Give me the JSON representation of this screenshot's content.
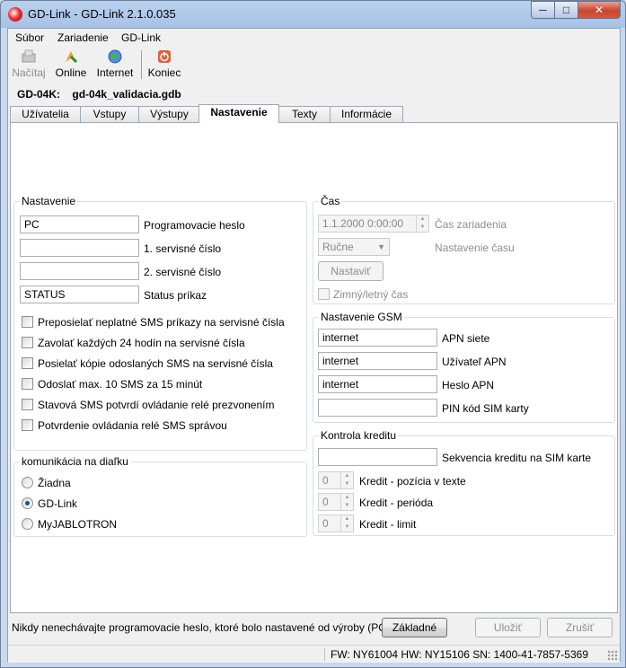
{
  "window": {
    "title": "GD-Link - GD-Link 2.1.0.035",
    "controls": {
      "minimize": "─",
      "maximize": "□",
      "close": "✕"
    }
  },
  "menu": [
    {
      "label": "Súbor"
    },
    {
      "label": "Zariadenie"
    },
    {
      "label": "GD-Link"
    }
  ],
  "toolbar": {
    "nacitaj": "Načítaj",
    "online": "Online",
    "internet": "Internet",
    "koniec": "Koniec"
  },
  "device": {
    "label": "GD-04K:",
    "file": "gd-04k_validacia.gdb"
  },
  "tabs": [
    {
      "label": "Užívatelia"
    },
    {
      "label": "Vstupy"
    },
    {
      "label": "Výstupy"
    },
    {
      "label": "Nastavenie",
      "active": true
    },
    {
      "label": "Texty"
    },
    {
      "label": "Informácie"
    }
  ],
  "settings": {
    "title": "Nastavenie",
    "fields": [
      {
        "value": "PC",
        "label": "Programovacie heslo"
      },
      {
        "value": "",
        "label": "1. servisné číslo"
      },
      {
        "value": "",
        "label": "2. servisné číslo"
      },
      {
        "value": "STATUS",
        "label": "Status príkaz"
      }
    ],
    "checkboxes": [
      {
        "label": "Preposielať neplatné SMS príkazy na servisné čísla",
        "checked": false
      },
      {
        "label": "Zavolať každých 24 hodín na servisné čísla",
        "checked": false
      },
      {
        "label": "Posielať kópie odoslaných SMS na servisné čísla",
        "checked": false
      },
      {
        "label": "Odoslať max.  10 SMS za 15 minút",
        "checked": false
      },
      {
        "label": "Stavová SMS potvrdí ovládanie relé prezvonením",
        "checked": false
      },
      {
        "label": "Potvrdenie ovládania relé SMS správou",
        "checked": false
      }
    ]
  },
  "remote": {
    "title": "komunikácia na diaľku",
    "options": [
      {
        "label": "Žiadna",
        "selected": false
      },
      {
        "label": "GD-Link",
        "selected": true
      },
      {
        "label": "MyJABLOTRON",
        "selected": false
      }
    ]
  },
  "time": {
    "title": "Čas",
    "device_time_value": "1.1.2000 0:00:00",
    "device_time_label": "Čas zariadenia",
    "mode_value": "Ručne",
    "mode_label": "Nastavenie času",
    "set_button": "Nastaviť",
    "dst_label": "Zimný/letný čas"
  },
  "gsm": {
    "title": "Nastavenie GSM",
    "fields": [
      {
        "value": "internet",
        "label": "APN siete"
      },
      {
        "value": "internet",
        "label": "Užívateľ APN"
      },
      {
        "value": "internet",
        "label": "Heslo APN"
      },
      {
        "value": "",
        "label": "PIN kód SIM karty"
      }
    ]
  },
  "credit": {
    "title": "Kontrola kreditu",
    "sequence_value": "",
    "sequence_label": "Sekvencia kreditu na SIM karte",
    "spinners": [
      {
        "value": "0",
        "label": "Kredit - pozícia v texte"
      },
      {
        "value": "0",
        "label": "Kredit - perióda"
      },
      {
        "value": "0",
        "label": "Kredit - limit"
      }
    ]
  },
  "footer": {
    "note": "Nikdy nenechávajte programovacie heslo, ktoré bolo nastavené od výroby (PC).",
    "btn_default": "Základné",
    "btn_save": "Uložiť",
    "btn_discard": "Zrušiť"
  },
  "status": "FW: NY61004 HW: NY15106 SN: 1400-41-7857-5369"
}
